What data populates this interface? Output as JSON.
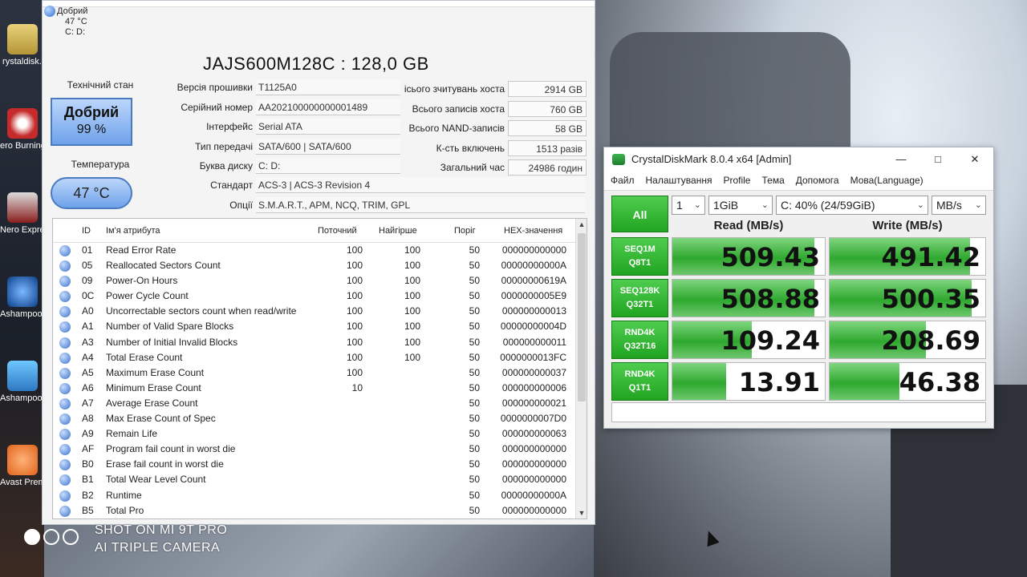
{
  "desktop": {
    "icons": [
      {
        "label": "rystaldisk.",
        "icon": "crystaldisk-icon"
      },
      {
        "label": "ero Burning ROM.exe",
        "icon": "nero-burning-rom-icon"
      },
      {
        "label": "Nero Express.exe",
        "icon": "nero-express-icon"
      },
      {
        "label": "Ashampoo Burning S...",
        "icon": "ashampoo-burning-icon"
      },
      {
        "label": "Ashampoo Deals",
        "icon": "ashampoo-deals-icon"
      },
      {
        "label": "Avast Premiu...",
        "icon": "avast-icon"
      }
    ]
  },
  "cdi": {
    "mini": {
      "status": "Добрий",
      "temp": "47 °C",
      "drives": "C: D:"
    },
    "model": "JAJS600M128C : 128,0 GB",
    "health": {
      "label": "Технічний стан",
      "status": "Добрий",
      "percent": "99 %"
    },
    "temperature": {
      "label": "Температура",
      "value": "47 °C"
    },
    "left_info": [
      {
        "key": "Версія прошивки",
        "value": "T1125A0"
      },
      {
        "key": "Серійний номер",
        "value": "AA202100000000001489"
      },
      {
        "key": "Інтерфейс",
        "value": "Serial ATA"
      },
      {
        "key": "Тип передачі",
        "value": "SATA/600 | SATA/600"
      },
      {
        "key": "Буква диску",
        "value": "C: D:"
      }
    ],
    "right_info": [
      {
        "key": "ісього зчитувань хоста",
        "value": "2914 GB"
      },
      {
        "key": "Всього записів хоста",
        "value": "760 GB"
      },
      {
        "key": "Всього NAND-записів",
        "value": "58 GB"
      },
      {
        "key": "К-сть включень",
        "value": "1513 разів"
      },
      {
        "key": "Загальний час",
        "value": "24986 годин"
      }
    ],
    "standard": {
      "key": "Стандарт",
      "value": "ACS-3 | ACS-3 Revision 4"
    },
    "options": {
      "key": "Опції",
      "value": "S.M.A.R.T., APM, NCQ, TRIM, GPL"
    },
    "table": {
      "headers": {
        "id": "ID",
        "name": "Ім'я атрибута",
        "current": "Поточний",
        "worst": "Найгірше",
        "threshold": "Поріг",
        "hex": "HEX-значення"
      },
      "rows": [
        {
          "id": "01",
          "name": "Read Error Rate",
          "current": "100",
          "worst": "100",
          "threshold": "50",
          "hex": "000000000000"
        },
        {
          "id": "05",
          "name": "Reallocated Sectors Count",
          "current": "100",
          "worst": "100",
          "threshold": "50",
          "hex": "00000000000A"
        },
        {
          "id": "09",
          "name": "Power-On Hours",
          "current": "100",
          "worst": "100",
          "threshold": "50",
          "hex": "00000000619A"
        },
        {
          "id": "0C",
          "name": "Power Cycle Count",
          "current": "100",
          "worst": "100",
          "threshold": "50",
          "hex": "0000000005E9"
        },
        {
          "id": "A0",
          "name": "Uncorrectable sectors count when read/write",
          "current": "100",
          "worst": "100",
          "threshold": "50",
          "hex": "000000000013"
        },
        {
          "id": "A1",
          "name": "Number of Valid Spare Blocks",
          "current": "100",
          "worst": "100",
          "threshold": "50",
          "hex": "00000000004D"
        },
        {
          "id": "A3",
          "name": "Number of Initial Invalid Blocks",
          "current": "100",
          "worst": "100",
          "threshold": "50",
          "hex": "000000000011"
        },
        {
          "id": "A4",
          "name": "Total Erase Count",
          "current": "100",
          "worst": "100",
          "threshold": "50",
          "hex": "0000000013FC"
        },
        {
          "id": "A5",
          "name": "Maximum Erase Count",
          "current": "100",
          "worst": "",
          "threshold": "50",
          "hex": "000000000037"
        },
        {
          "id": "A6",
          "name": "Minimum Erase Count",
          "current": "10",
          "worst": "",
          "threshold": "50",
          "hex": "000000000006"
        },
        {
          "id": "A7",
          "name": "Average Erase Count",
          "current": "",
          "worst": "",
          "threshold": "50",
          "hex": "000000000021"
        },
        {
          "id": "A8",
          "name": "Max Erase Count of Spec",
          "current": "",
          "worst": "",
          "threshold": "50",
          "hex": "0000000007D0"
        },
        {
          "id": "A9",
          "name": "Remain Life",
          "current": "",
          "worst": "",
          "threshold": "50",
          "hex": "000000000063"
        },
        {
          "id": "AF",
          "name": "Program fail count in worst die",
          "current": "",
          "worst": "",
          "threshold": "50",
          "hex": "000000000000"
        },
        {
          "id": "B0",
          "name": "Erase fail count in worst die",
          "current": "",
          "worst": "",
          "threshold": "50",
          "hex": "000000000000"
        },
        {
          "id": "B1",
          "name": "Total Wear Level Count",
          "current": "",
          "worst": "",
          "threshold": "50",
          "hex": "000000000000"
        },
        {
          "id": "B2",
          "name": "Runtime",
          "current": "",
          "worst": "",
          "threshold": "50",
          "hex": "00000000000A"
        },
        {
          "id": "B5",
          "name": "Total Pro",
          "current": "",
          "worst": "",
          "threshold": "50",
          "hex": "000000000000"
        }
      ]
    }
  },
  "cdm": {
    "title": "CrystalDiskMark 8.0.4 x64 [Admin]",
    "menu": [
      "Файл",
      "Налаштування",
      "Profile",
      "Тема",
      "Допомога",
      "Мова(Language)"
    ],
    "all_label": "All",
    "count": "1",
    "size": "1GiB",
    "drive": "C: 40% (24/59GiB)",
    "unit": "MB/s",
    "read_header": "Read (MB/s)",
    "write_header": "Write (MB/s)",
    "tests": [
      {
        "l1": "SEQ1M",
        "l2": "Q8T1",
        "read": "509.43",
        "write": "491.42",
        "read_frac": 0.93,
        "write_frac": 0.9
      },
      {
        "l1": "SEQ128K",
        "l2": "Q32T1",
        "read": "508.88",
        "write": "500.35",
        "read_frac": 0.93,
        "write_frac": 0.91
      },
      {
        "l1": "RND4K",
        "l2": "Q32T16",
        "read": "109.24",
        "write": "208.69",
        "read_frac": 0.52,
        "write_frac": 0.62
      },
      {
        "l1": "RND4K",
        "l2": "Q1T1",
        "read": "13.91",
        "write": "46.38",
        "read_frac": 0.35,
        "write_frac": 0.45
      }
    ],
    "colors": {
      "accent": "#21a521"
    }
  },
  "watermark": {
    "line1": "SHOT ON MI 9T PRO",
    "line2": "AI TRIPLE CAMERA"
  }
}
